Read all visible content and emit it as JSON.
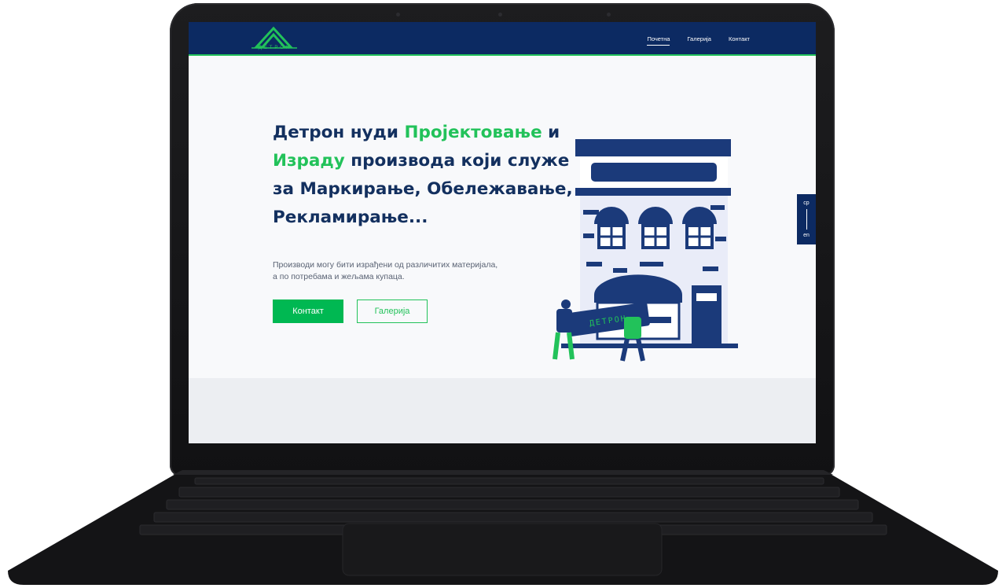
{
  "logo": {
    "text": "ДЕТРОН"
  },
  "nav": {
    "items": [
      {
        "label": "Почетна",
        "active": true
      },
      {
        "label": "Галерија",
        "active": false
      },
      {
        "label": "Контакт",
        "active": false
      }
    ]
  },
  "hero": {
    "headline_parts": {
      "p1": "Детрон нуди ",
      "h1": "Пројектовање",
      "p2": " и ",
      "h2": "Израду",
      "p3": " производа који служе за Маркирање, Обележавање, Рекламирање..."
    },
    "subtext": "Производи могу бити израђени од различитих материјала, а по потребама и жељама купаца.",
    "primary_button": "Контакт",
    "secondary_button": "Галерија",
    "sign_text": "ДЕТРОН"
  },
  "lang_toggle": {
    "top": "ср",
    "bottom": "en"
  },
  "colors": {
    "navy": "#0c2a62",
    "green": "#22c25a",
    "button_green": "#00b852"
  }
}
